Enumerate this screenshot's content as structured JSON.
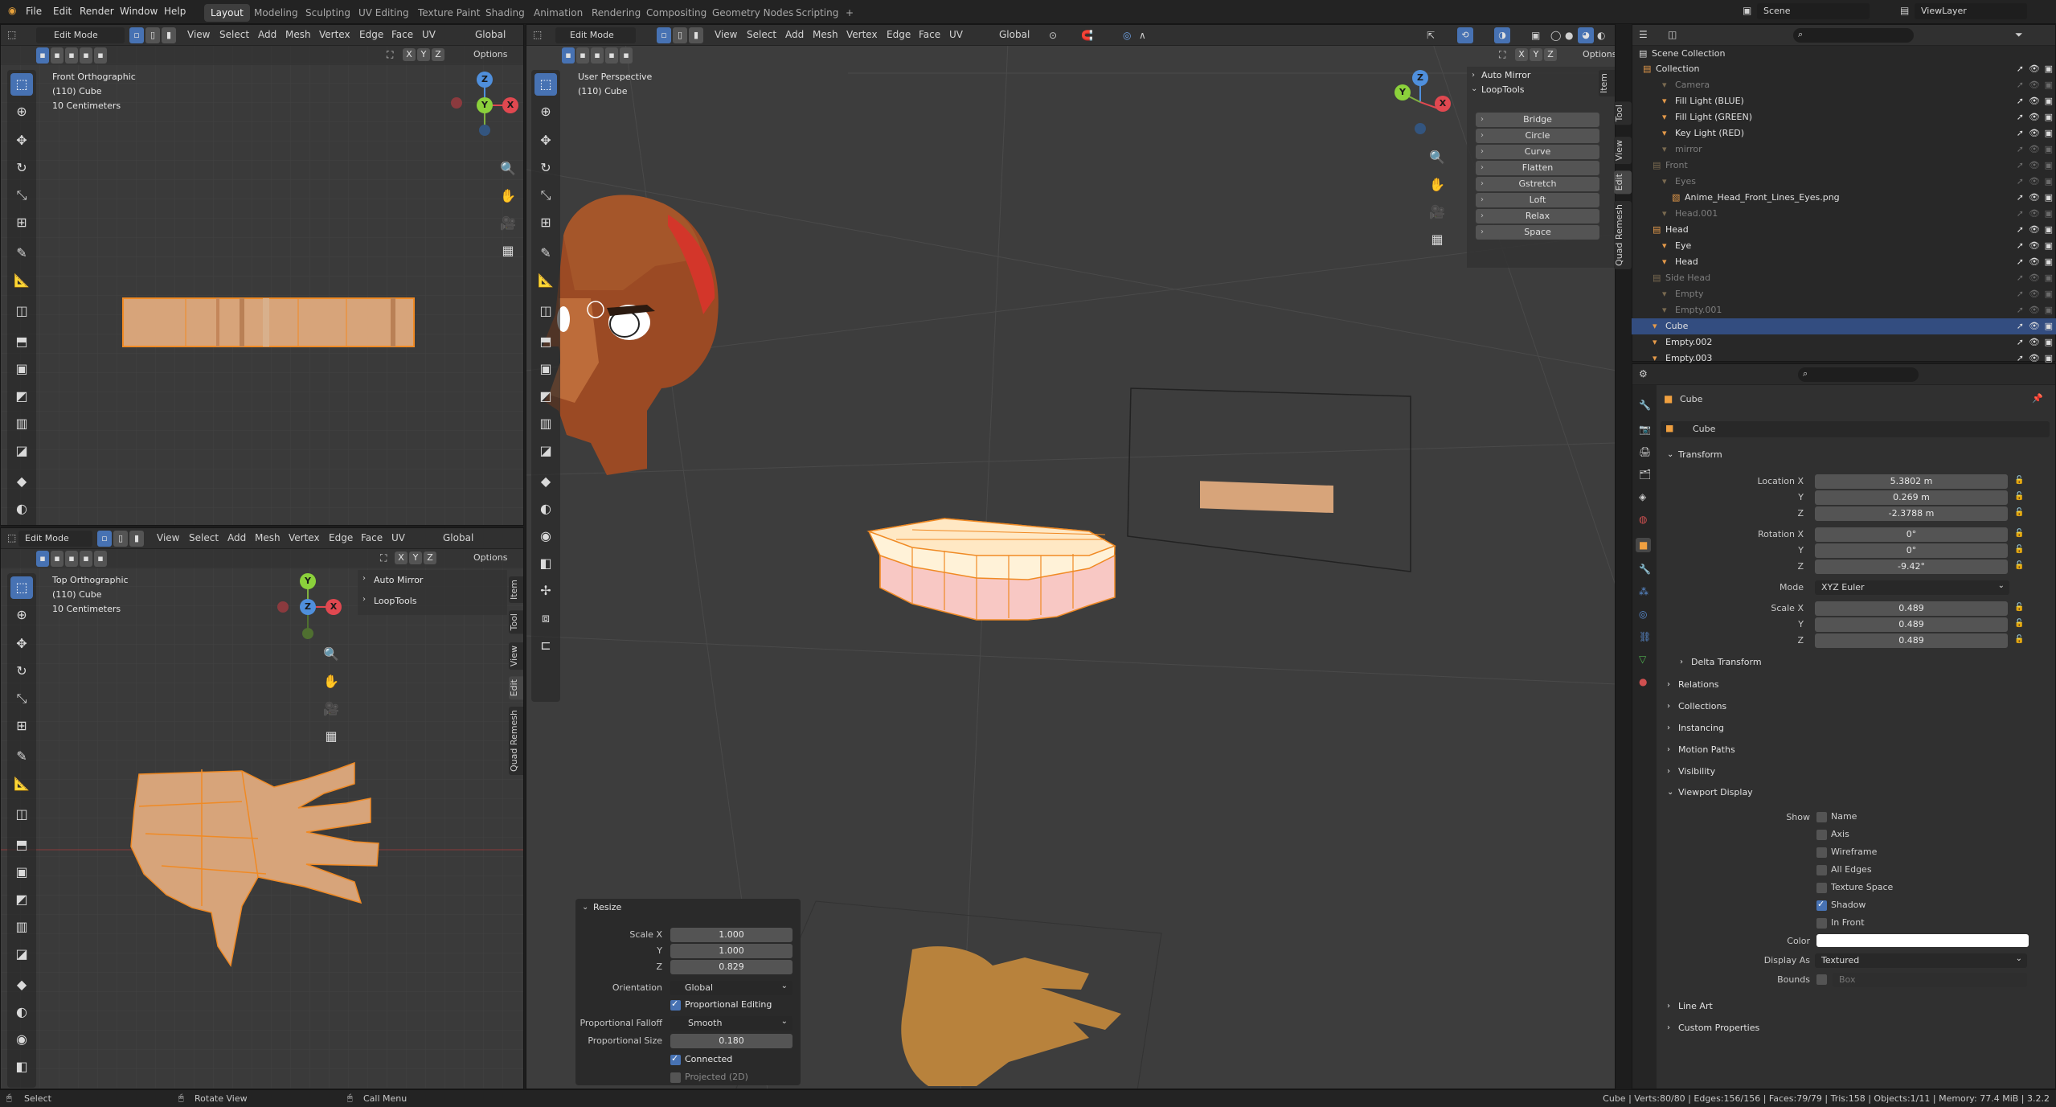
{
  "topbar": {
    "menus": [
      "File",
      "Edit",
      "Render",
      "Window",
      "Help"
    ],
    "workspaces": [
      "Layout",
      "Modeling",
      "Sculpting",
      "UV Editing",
      "Texture Paint",
      "Shading",
      "Animation",
      "Rendering",
      "Compositing",
      "Geometry Nodes",
      "Scripting",
      "+"
    ],
    "active_workspace": "Layout",
    "scene": "Scene",
    "view_layer": "ViewLayer"
  },
  "viewport_header": {
    "mode": "Edit Mode",
    "menus": [
      "View",
      "Select",
      "Add",
      "Mesh",
      "Vertex",
      "Edge",
      "Face",
      "UV"
    ],
    "orientation": "Global",
    "options": "Options",
    "axes": [
      "X",
      "Y",
      "Z"
    ]
  },
  "vp_front": {
    "title": "Front Orthographic",
    "object": "(110) Cube",
    "scale": "10 Centimeters"
  },
  "vp_top": {
    "title": "Top Orthographic",
    "object": "(110) Cube",
    "scale": "10 Centimeters"
  },
  "vp_persp": {
    "title": "User Perspective",
    "object": "(110) Cube"
  },
  "gizmo": {
    "x": "X",
    "y": "Y",
    "z": "Z"
  },
  "sidebar_tabs": [
    "Item",
    "Tool",
    "View",
    "Edit",
    "Quad Remesh"
  ],
  "n_panel": {
    "auto_mirror": "Auto Mirror",
    "looptools": "LoopTools",
    "loop_buttons": [
      "Bridge",
      "Circle",
      "Curve",
      "Flatten",
      "Gstretch",
      "Loft",
      "Relax",
      "Space"
    ]
  },
  "resize_panel": {
    "title": "Resize",
    "scale_x_label": "Scale X",
    "scale_x": "1.000",
    "y_label": "Y",
    "scale_y": "1.000",
    "z_label": "Z",
    "scale_z": "0.829",
    "orientation_label": "Orientation",
    "orientation": "Global",
    "prop_edit_label": "Proportional Editing",
    "falloff_label": "Proportional Falloff",
    "falloff": "Smooth",
    "size_label": "Proportional Size",
    "size": "0.180",
    "connected_label": "Connected",
    "projected_label": "Projected (2D)"
  },
  "outliner": {
    "root": "Scene Collection",
    "rows": [
      {
        "name": "Collection",
        "indent": 0,
        "dim": false,
        "sel": false
      },
      {
        "name": "Camera",
        "indent": 2,
        "dim": true,
        "sel": false
      },
      {
        "name": "Fill Light (BLUE)",
        "indent": 2,
        "dim": false,
        "sel": false
      },
      {
        "name": "Fill Light (GREEN)",
        "indent": 2,
        "dim": false,
        "sel": false
      },
      {
        "name": "Key Light (RED)",
        "indent": 2,
        "dim": false,
        "sel": false
      },
      {
        "name": "mirror",
        "indent": 2,
        "dim": true,
        "sel": false
      },
      {
        "name": "Front",
        "indent": 1,
        "dim": true,
        "sel": false
      },
      {
        "name": "Eyes",
        "indent": 2,
        "dim": true,
        "sel": false
      },
      {
        "name": "Anime_Head_Front_Lines_Eyes.png",
        "indent": 3,
        "dim": false,
        "sel": false
      },
      {
        "name": "Head.001",
        "indent": 2,
        "dim": true,
        "sel": false
      },
      {
        "name": "Head",
        "indent": 1,
        "dim": false,
        "sel": false
      },
      {
        "name": "Eye",
        "indent": 2,
        "dim": false,
        "sel": false
      },
      {
        "name": "Head",
        "indent": 2,
        "dim": false,
        "sel": false
      },
      {
        "name": "Side Head",
        "indent": 1,
        "dim": true,
        "sel": false
      },
      {
        "name": "Empty",
        "indent": 2,
        "dim": true,
        "sel": false
      },
      {
        "name": "Empty.001",
        "indent": 2,
        "dim": true,
        "sel": false
      },
      {
        "name": "Cube",
        "indent": 1,
        "dim": false,
        "sel": true
      },
      {
        "name": "Empty.002",
        "indent": 1,
        "dim": false,
        "sel": false
      },
      {
        "name": "Empty.003",
        "indent": 1,
        "dim": false,
        "sel": false
      }
    ]
  },
  "properties": {
    "object_name": "Cube",
    "data_name": "Cube",
    "transform": "Transform",
    "location_label": "Location X",
    "loc_x": "5.3802 m",
    "loc_y": "0.269 m",
    "loc_z": "-2.3788 m",
    "rotation_label": "Rotation X",
    "rot_x": "0°",
    "rot_y": "0°",
    "rot_z": "-9.42°",
    "y": "Y",
    "z": "Z",
    "mode_label": "Mode",
    "mode": "XYZ Euler",
    "scale_label": "Scale X",
    "scale_x": "0.489",
    "scale_y": "0.489",
    "scale_z": "0.489",
    "delta": "Delta Transform",
    "sections": [
      "Relations",
      "Collections",
      "Instancing",
      "Motion Paths",
      "Visibility"
    ],
    "viewport_display": "Viewport Display",
    "show_label": "Show",
    "show_items": [
      {
        "label": "Name",
        "on": false
      },
      {
        "label": "Axis",
        "on": false
      },
      {
        "label": "Wireframe",
        "on": false
      },
      {
        "label": "All Edges",
        "on": false
      },
      {
        "label": "Texture Space",
        "on": false
      },
      {
        "label": "Shadow",
        "on": true
      },
      {
        "label": "In Front",
        "on": false
      }
    ],
    "color_label": "Color",
    "display_as_label": "Display As",
    "display_as": "Textured",
    "bounds_label": "Bounds",
    "bounds": "Box",
    "line_art": "Line Art",
    "custom_props": "Custom Properties"
  },
  "status": {
    "select": "Select",
    "rotate": "Rotate View",
    "call_menu": "Call Menu",
    "stats": "Cube | Verts:80/80 | Edges:156/156 | Faces:79/79 | Tris:158 | Objects:1/11 | Memory: 77.4 MiB | 3.2.2"
  }
}
